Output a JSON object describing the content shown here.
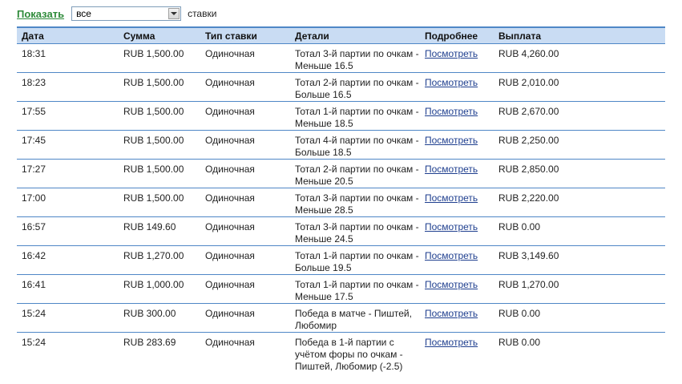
{
  "filter": {
    "show_label": "Показать",
    "select_value": "все",
    "after_label": "ставки"
  },
  "table": {
    "headers": [
      "Дата",
      "Сумма",
      "Тип ставки",
      "Детали",
      "Подробнее",
      "Выплата"
    ],
    "rows": [
      {
        "date": "18:31",
        "amount": "RUB 1,500.00",
        "type": "Одиночная",
        "details": "Тотал 3-й партии по очкам - Меньше 16.5",
        "more": "Посмотреть",
        "payout": "RUB 4,260.00"
      },
      {
        "date": "18:23",
        "amount": "RUB 1,500.00",
        "type": "Одиночная",
        "details": "Тотал 2-й партии по очкам - Больше 16.5",
        "more": "Посмотреть",
        "payout": "RUB 2,010.00"
      },
      {
        "date": "17:55",
        "amount": "RUB 1,500.00",
        "type": "Одиночная",
        "details": "Тотал 1-й партии по очкам - Меньше 18.5",
        "more": "Посмотреть",
        "payout": "RUB 2,670.00"
      },
      {
        "date": "17:45",
        "amount": "RUB 1,500.00",
        "type": "Одиночная",
        "details": "Тотал 4-й партии по очкам - Больше 18.5",
        "more": "Посмотреть",
        "payout": "RUB 2,250.00"
      },
      {
        "date": "17:27",
        "amount": "RUB 1,500.00",
        "type": "Одиночная",
        "details": "Тотал 2-й партии по очкам - Меньше 20.5",
        "more": "Посмотреть",
        "payout": "RUB 2,850.00"
      },
      {
        "date": "17:00",
        "amount": "RUB 1,500.00",
        "type": "Одиночная",
        "details": "Тотал 3-й партии по очкам - Меньше 28.5",
        "more": "Посмотреть",
        "payout": "RUB 2,220.00"
      },
      {
        "date": "16:57",
        "amount": "RUB 149.60",
        "type": "Одиночная",
        "details": "Тотал 3-й партии по очкам - Меньше 24.5",
        "more": "Посмотреть",
        "payout": "RUB 0.00"
      },
      {
        "date": "16:42",
        "amount": "RUB 1,270.00",
        "type": "Одиночная",
        "details": "Тотал 1-й партии по очкам - Больше 19.5",
        "more": "Посмотреть",
        "payout": "RUB 3,149.60"
      },
      {
        "date": "16:41",
        "amount": "RUB 1,000.00",
        "type": "Одиночная",
        "details": "Тотал 1-й партии по очкам - Меньше 17.5",
        "more": "Посмотреть",
        "payout": "RUB 1,270.00"
      },
      {
        "date": "15:24",
        "amount": "RUB 300.00",
        "type": "Одиночная",
        "details": "Победа в матче - Пиштей, Любомир",
        "more": "Посмотреть",
        "payout": "RUB 0.00"
      },
      {
        "date": "15:24",
        "amount": "RUB 283.69",
        "type": "Одиночная",
        "details": "Победа в 1-й партии с учётом форы по очкам - Пиштей, Любомир (-2.5)",
        "more": "Посмотреть",
        "payout": "RUB 0.00"
      }
    ]
  },
  "colors": {
    "header_bg": "#c9dcf3",
    "border": "#4f87c6",
    "show_link": "#2e8b3a",
    "details_link": "#1f3f8f"
  }
}
